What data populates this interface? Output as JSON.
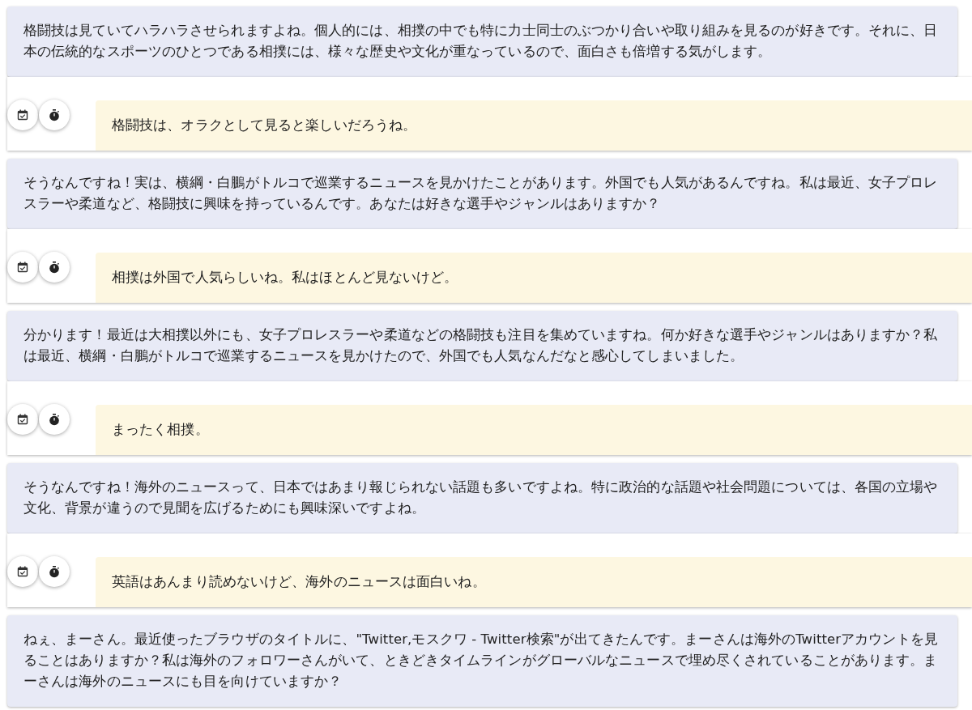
{
  "messages": [
    {
      "kind": "assistant",
      "text": "格闘技は見ていてハラハラさせられますよね。個人的には、相撲の中でも特に力士同士のぶつかり合いや取り組みを見るのが好きです。それに、日本の伝統的なスポーツのひとつである相撲には、様々な歴史や文化が重なっているので、面白さも倍増する気がします。"
    },
    {
      "kind": "user",
      "text": "格闘技は、オラクとして見ると楽しいだろうね。"
    },
    {
      "kind": "assistant",
      "text": "そうなんですね！実は、横綱・白鵬がトルコで巡業するニュースを見かけたことがあります。外国でも人気があるんですね。私は最近、女子プロレスラーや柔道など、格闘技に興味を持っているんです。あなたは好きな選手やジャンルはありますか？"
    },
    {
      "kind": "user",
      "text": "相撲は外国で人気らしいね。私はほとんど見ないけど。"
    },
    {
      "kind": "assistant",
      "text": "分かります！最近は大相撲以外にも、女子プロレスラーや柔道などの格闘技も注目を集めていますね。何か好きな選手やジャンルはありますか？私は最近、横綱・白鵬がトルコで巡業するニュースを見かけたので、外国でも人気なんだなと感心してしまいました。"
    },
    {
      "kind": "user",
      "text": "まったく相撲。"
    },
    {
      "kind": "assistant",
      "text": "そうなんですね！海外のニュースって、日本ではあまり報じられない話題も多いですよね。特に政治的な話題や社会問題については、各国の立場や文化、背景が違うので見聞を広げるためにも興味深いですよね。"
    },
    {
      "kind": "user",
      "text": "英語はあんまり読めないけど、海外のニュースは面白いね。"
    },
    {
      "kind": "assistant",
      "text": "ねぇ、まーさん。最近使ったブラウザのタイトルに、\"Twitter,モスクワ - Twitter検索\"が出てきたんです。まーさんは海外のTwitterアカウントを見ることはありますか？私は海外のフォロワーさんがいて、ときどきタイムラインがグローバルなニュースで埋め尽くされていることがあります。まーさんは海外のニュースにも目を向けていますか？"
    }
  ]
}
